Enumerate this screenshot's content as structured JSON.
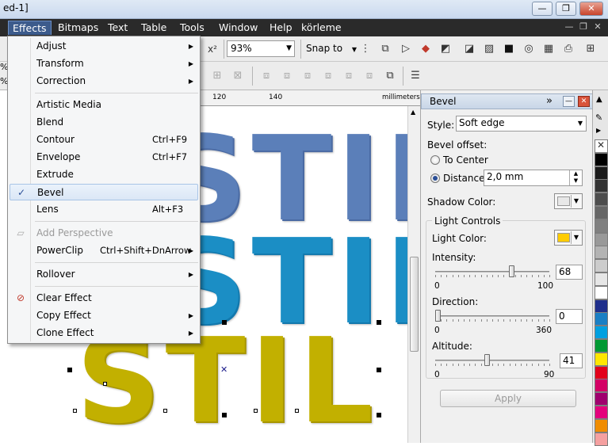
{
  "window": {
    "title": "ed-1]",
    "controls": {
      "minimize": "—",
      "restore": "❐",
      "close": "✕"
    }
  },
  "menubar": {
    "items": [
      "Effects",
      "Bitmaps",
      "Text",
      "Table",
      "Tools",
      "Window",
      "Help",
      "körleme"
    ]
  },
  "toolbar": {
    "zoom": "93%",
    "snap_to": "Snap to",
    "superscript_label": "x²"
  },
  "ruler": {
    "labels": [
      "120",
      "140",
      "millimeters"
    ]
  },
  "left_ruler_marks": [
    "%",
    "%"
  ],
  "effects_menu": {
    "items": [
      {
        "label": "Adjust",
        "submenu": true
      },
      {
        "label": "Transform",
        "submenu": true
      },
      {
        "label": "Correction",
        "submenu": true
      },
      {
        "label": "Artistic Media"
      },
      {
        "label": "Blend"
      },
      {
        "label": "Contour",
        "shortcut": "Ctrl+F9"
      },
      {
        "label": "Envelope",
        "shortcut": "Ctrl+F7"
      },
      {
        "label": "Extrude"
      },
      {
        "label": "Bevel",
        "checked": true,
        "check_glyph": "✓"
      },
      {
        "label": "Lens",
        "shortcut": "Alt+F3"
      },
      {
        "label": "Add Perspective",
        "disabled": true
      },
      {
        "label": "PowerClip",
        "shortcut": "Ctrl+Shift+DnArrow",
        "submenu": true
      },
      {
        "label": "Rollover",
        "submenu": true
      },
      {
        "label": "Clear Effect"
      },
      {
        "label": "Copy Effect",
        "submenu": true
      },
      {
        "label": "Clone Effect",
        "submenu": true
      }
    ]
  },
  "canvas": {
    "words": [
      {
        "text": "STIL",
        "color": "#5b7fb9",
        "face": "#4a6aa3"
      },
      {
        "text": "STIL",
        "color": "#1b8ec5",
        "face": "#1278ad"
      },
      {
        "text": "STIL",
        "color": "#c2b000",
        "face": "#a89600"
      }
    ]
  },
  "docker": {
    "title": "Bevel",
    "style_label": "Style:",
    "style_value": "Soft edge",
    "bevel_offset_label": "Bevel offset:",
    "to_center": "To Center",
    "distance_label": "Distance:",
    "distance_value": "2,0 mm",
    "shadow_color_label": "Shadow Color:",
    "shadow_color": "#e8e8e8",
    "light_controls_label": "Light Controls",
    "light_color_label": "Light Color:",
    "light_color": "#ffcc00",
    "intensity": {
      "label": "Intensity:",
      "min": "0",
      "max": "100",
      "value": "68"
    },
    "direction": {
      "label": "Direction:",
      "min": "0",
      "max": "360",
      "value": "0"
    },
    "altitude": {
      "label": "Altitude:",
      "min": "0",
      "max": "90",
      "value": "41"
    },
    "apply": "Apply"
  },
  "palette": {
    "colors": [
      "#ffffff",
      "#000000",
      "#1a1a1a",
      "#333333",
      "#4d4d4d",
      "#666666",
      "#808080",
      "#999999",
      "#b3b3b3",
      "#cccccc",
      "#e6e6e6",
      "#ffffff",
      "#1f2f8c",
      "#1a7fc4",
      "#00a0e0",
      "#009933",
      "#ffe600",
      "#e2001a",
      "#d40065",
      "#a0006e",
      "#e4007c",
      "#f08c00",
      "#f5a0a0"
    ]
  }
}
